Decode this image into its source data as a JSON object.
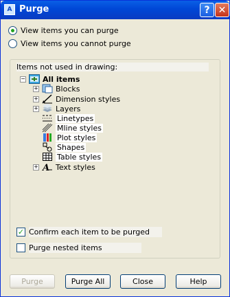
{
  "window": {
    "title": "Purge",
    "app_icon": "autocad-icon"
  },
  "radios": [
    {
      "label": "View items you can purge",
      "checked": true
    },
    {
      "label": "View items you cannot purge",
      "checked": false
    }
  ],
  "group": {
    "label": "Items not used in drawing:"
  },
  "tree": {
    "root": {
      "label": "All items",
      "expander": "−",
      "icon": "all-items-icon"
    },
    "items": [
      {
        "label": "Blocks",
        "expander": "+",
        "icon": "blocks-icon"
      },
      {
        "label": "Dimension styles",
        "expander": "+",
        "icon": "dimension-styles-icon"
      },
      {
        "label": "Layers",
        "expander": "+",
        "icon": "layers-icon"
      },
      {
        "label": "Linetypes",
        "expander": "",
        "icon": "linetypes-icon"
      },
      {
        "label": "Mline styles",
        "expander": "",
        "icon": "mline-styles-icon"
      },
      {
        "label": "Plot styles",
        "expander": "",
        "icon": "plot-styles-icon"
      },
      {
        "label": "Shapes",
        "expander": "",
        "icon": "shapes-icon"
      },
      {
        "label": "Table styles",
        "expander": "",
        "icon": "table-styles-icon"
      },
      {
        "label": "Text styles",
        "expander": "+",
        "icon": "text-styles-icon"
      }
    ]
  },
  "checkboxes": [
    {
      "label": "Confirm each item to be purged",
      "checked": true
    },
    {
      "label": "Purge nested items",
      "checked": false
    }
  ],
  "buttons": [
    {
      "label": "Purge",
      "disabled": true
    },
    {
      "label": "Purge All",
      "disabled": false
    },
    {
      "label": "Close",
      "disabled": false
    },
    {
      "label": "Help",
      "disabled": false
    }
  ],
  "colors": {
    "titlebar": "#0047d6",
    "dialog_bg": "#ece9d8",
    "check_green": "#21a121"
  }
}
